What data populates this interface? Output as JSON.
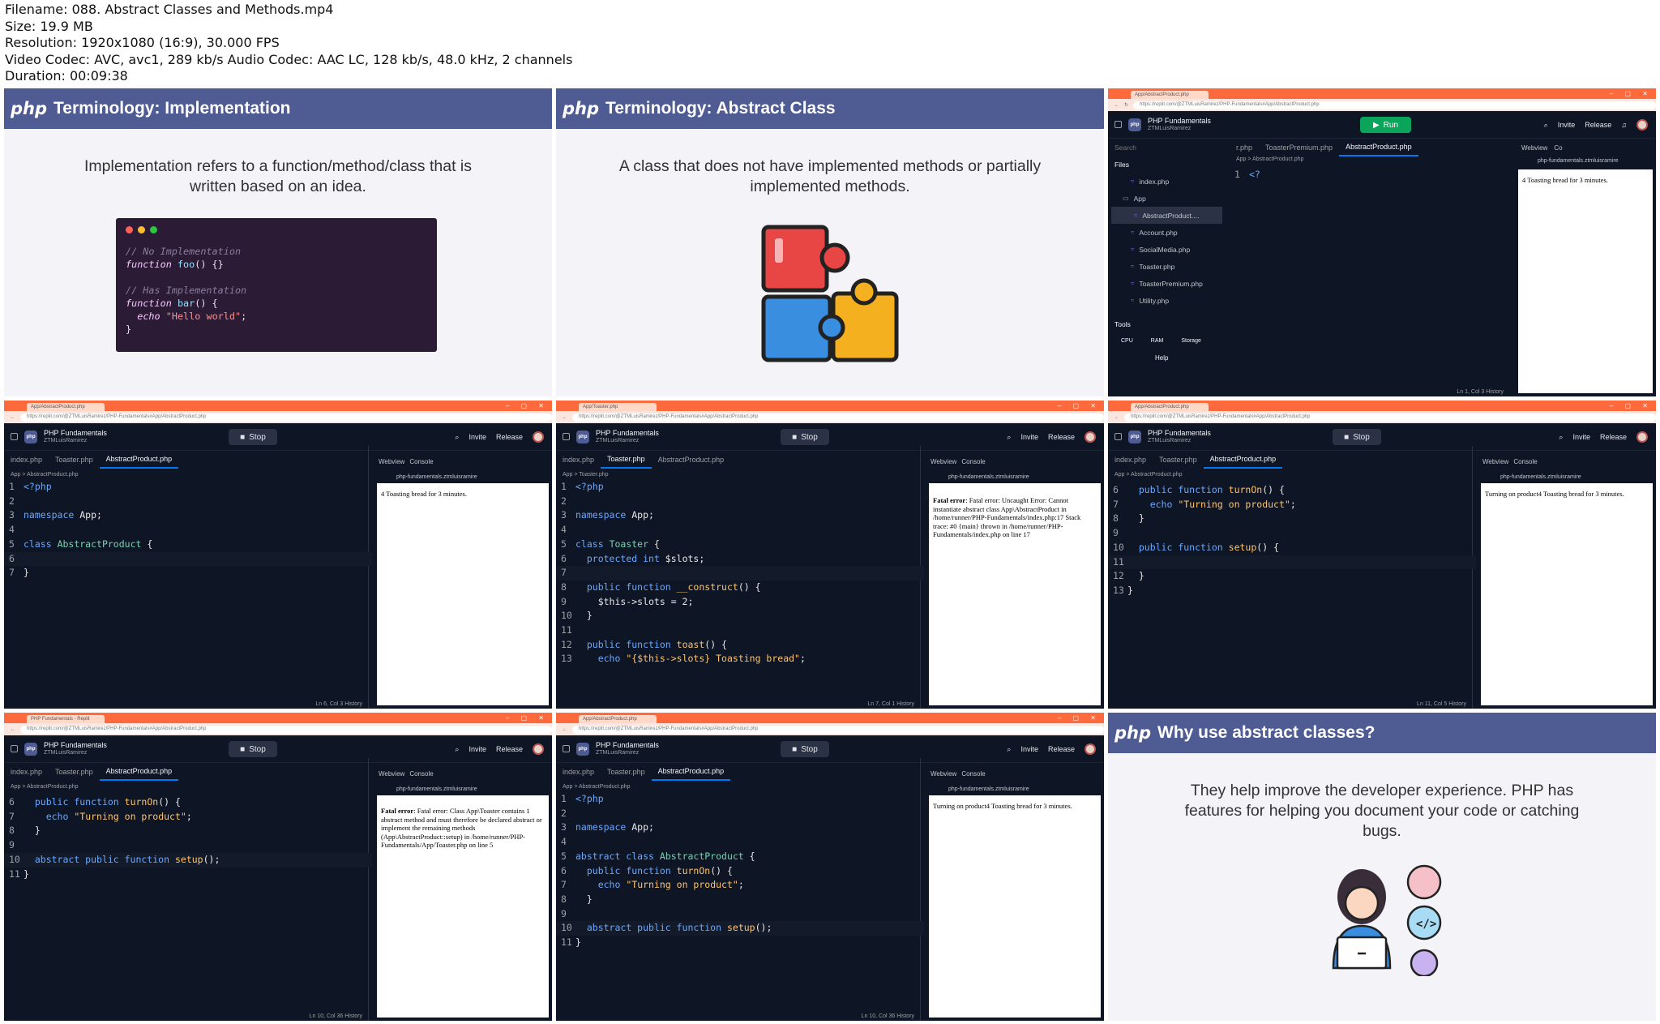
{
  "meta": {
    "filename": "Filename: 088. Abstract Classes and Methods.mp4",
    "size": "Size: 19.9 MB",
    "resolution": "Resolution: 1920x1080 (16:9), 30.000 FPS",
    "codec": "Video Codec: AVC, avc1, 289 kb/s Audio Codec: AAC LC, 128 kb/s, 48.0 kHz, 2 channels",
    "duration": "Duration: 00:09:38"
  },
  "slide1": {
    "php": "php",
    "title": "Terminology: Implementation",
    "text": "Implementation refers to a function/method/class that is written based on an idea.",
    "code": [
      "// No Implementation",
      "function foo() {}",
      "",
      "// Has Implementation",
      "function bar() {",
      "  echo \"Hello world\";",
      "}"
    ]
  },
  "slide2": {
    "php": "php",
    "title": "Terminology: Abstract Class",
    "text": "A class that does not have implemented methods or partially implemented methods."
  },
  "slide9": {
    "php": "php",
    "title": "Why use abstract classes?",
    "text": "They help improve the developer experience. PHP has features for helping you document your code or catching bugs."
  },
  "ide": {
    "project": "PHP Fundamentals",
    "user": "ZTMLuisRamirez",
    "stop": "Stop",
    "run": "Run",
    "invite": "Invite",
    "release": "Release",
    "webview": "Webview",
    "console": "Console",
    "weburl": "php-fundamentals.ztmluisramire",
    "url": "https://replit.com/@ZTMLuisRamirez/PHP-Fundamentals#App/AbstractProduct.php",
    "files_label": "Files",
    "tools_label": "Tools",
    "help": "Help",
    "search": "Search",
    "file_tree": [
      "index.php",
      "App",
      "AbstractProduct....",
      "Account.php",
      "SocialMedia.php",
      "Toaster.php",
      "ToasterPremium.php",
      "Utility.php"
    ],
    "cpu": "CPU",
    "ram": "RAM",
    "storage": "Storage"
  },
  "tile3": {
    "tabs": [
      "r.php",
      "ToasterPremium.php",
      "AbstractProduct.php",
      "Webview",
      "Co"
    ],
    "crumb": "App  >  AbstractProduct.php",
    "output": "4 Toasting bread for 3 minutes.",
    "status": "Ln 1, Col 3   History"
  },
  "tile4": {
    "tabs": [
      "index.php",
      "Toaster.php",
      "AbstractProduct.php"
    ],
    "output": "4 Toasting bread for 3 minutes.",
    "status": "Ln 6, Col 3   History"
  },
  "tile5": {
    "tabs": [
      "index.php",
      "Toaster.php",
      "AbstractProduct.php"
    ],
    "output": "Fatal error: Uncaught Error: Cannot instantiate abstract class App\\AbstractProduct in /home/runner/PHP-Fundamentals/index.php:17 Stack trace: #0 {main} thrown in /home/runner/PHP-Fundamentals/index.php on line 17",
    "status": "Ln 7, Col 1   History"
  },
  "tile6": {
    "tabs": [
      "index.php",
      "Toaster.php",
      "AbstractProduct.php"
    ],
    "output": "Turning on product4 Toasting bread for 3 minutes.",
    "status": "Ln 11, Col 5   History"
  },
  "tile7": {
    "tabs": [
      "index.php",
      "Toaster.php",
      "AbstractProduct.php"
    ],
    "output": "Fatal error: Class App\\Toaster contains 1 abstract method and must therefore be declared abstract or implement the remaining methods (App\\AbstractProduct::setup) in /home/runner/PHP-Fundamentals/App/Toaster.php on line 5",
    "status": "Ln 10, Col 36   History"
  },
  "tile8": {
    "tabs": [
      "index.php",
      "Toaster.php",
      "AbstractProduct.php"
    ],
    "output": "Turning on product4 Toasting bread for 3 minutes.",
    "status": "Ln 10, Col 36   History"
  },
  "colors": {
    "slide_header": "#4f5b93",
    "ide_bg": "#0e1525",
    "chrome": "#ff6a3d"
  }
}
